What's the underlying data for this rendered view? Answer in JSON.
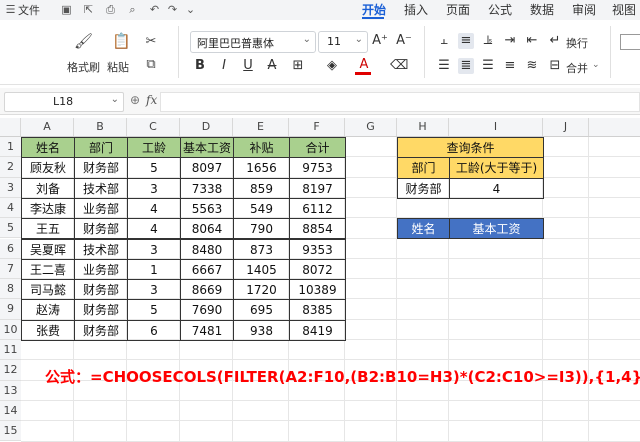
{
  "topbar": {
    "file_label": "文件",
    "tabs": [
      "开始",
      "插入",
      "页面",
      "公式",
      "数据",
      "审阅",
      "视图"
    ],
    "active_tab": "开始"
  },
  "ribbon": {
    "format_painter": "格式刷",
    "paste": "粘贴",
    "font_name": "阿里巴巴普惠体",
    "font_size": "11",
    "wrap": "换行",
    "merge": "合并"
  },
  "formula_bar": {
    "name_box": "L18",
    "fx": "fx",
    "content": ""
  },
  "grid": {
    "columns": [
      "A",
      "B",
      "C",
      "D",
      "E",
      "F",
      "G",
      "H",
      "I",
      "J"
    ],
    "rows": [
      "1",
      "2",
      "3",
      "4",
      "5",
      "6",
      "7",
      "8",
      "9",
      "10",
      "11",
      "12",
      "13",
      "14",
      "15"
    ],
    "headers": [
      "姓名",
      "部门",
      "工龄",
      "基本工资",
      "补贴",
      "合计"
    ],
    "records": [
      [
        "顾友秋",
        "财务部",
        "5",
        "8097",
        "1656",
        "9753"
      ],
      [
        "刘备",
        "技术部",
        "3",
        "7338",
        "859",
        "8197"
      ],
      [
        "李达康",
        "业务部",
        "4",
        "5563",
        "549",
        "6112"
      ],
      [
        "王五",
        "财务部",
        "4",
        "8064",
        "790",
        "8854"
      ],
      [
        "吴夏晖",
        "技术部",
        "3",
        "8480",
        "873",
        "9353"
      ],
      [
        "王二喜",
        "业务部",
        "1",
        "6667",
        "1405",
        "8072"
      ],
      [
        "司马懿",
        "财务部",
        "3",
        "8669",
        "1720",
        "10389"
      ],
      [
        "赵涛",
        "财务部",
        "5",
        "7690",
        "695",
        "8385"
      ],
      [
        "张费",
        "财务部",
        "6",
        "7481",
        "938",
        "8419"
      ]
    ]
  },
  "query": {
    "title": "查询条件",
    "dept_label": "部门",
    "age_label": "工龄(大于等于)",
    "dept_value": "财务部",
    "age_value": "4",
    "result_name": "姓名",
    "result_salary": "基本工资"
  },
  "formula_note": "公式：=CHOOSECOLS(FILTER(A2:F10,(B2:B10=H3)*(C2:C10>=I3)),{1,4})",
  "colors": {
    "accent": "#1a5fd6",
    "header_green": "#a9d08e",
    "header_yellow": "#ffd966",
    "header_blue": "#4472c4",
    "formula_red": "#ff0000"
  }
}
